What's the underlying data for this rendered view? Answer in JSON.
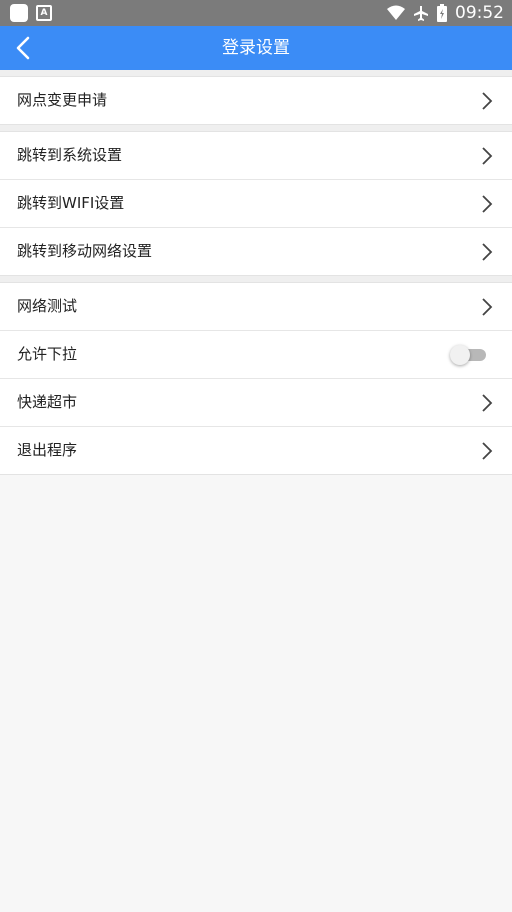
{
  "status_bar": {
    "time": "09:52",
    "icons": [
      "app-icon",
      "text-app-icon",
      "wifi-icon",
      "airplane-icon",
      "battery-icon"
    ],
    "app2_glyph": "A"
  },
  "header": {
    "title": "登录设置",
    "color": "#3b8cf6",
    "back_icon": "chevron-left-icon"
  },
  "groups": [
    {
      "items": [
        {
          "label": "网点变更申请",
          "control": "chevron"
        }
      ]
    },
    {
      "items": [
        {
          "label": "跳转到系统设置",
          "control": "chevron"
        },
        {
          "label": "跳转到WIFI设置",
          "control": "chevron"
        },
        {
          "label": "跳转到移动网络设置",
          "control": "chevron"
        }
      ]
    },
    {
      "items": [
        {
          "label": "网络测试",
          "control": "chevron"
        },
        {
          "label": "允许下拉",
          "control": "toggle",
          "toggle_on": false
        },
        {
          "label": "快递超市",
          "control": "chevron"
        },
        {
          "label": "退出程序",
          "control": "chevron"
        }
      ]
    }
  ]
}
